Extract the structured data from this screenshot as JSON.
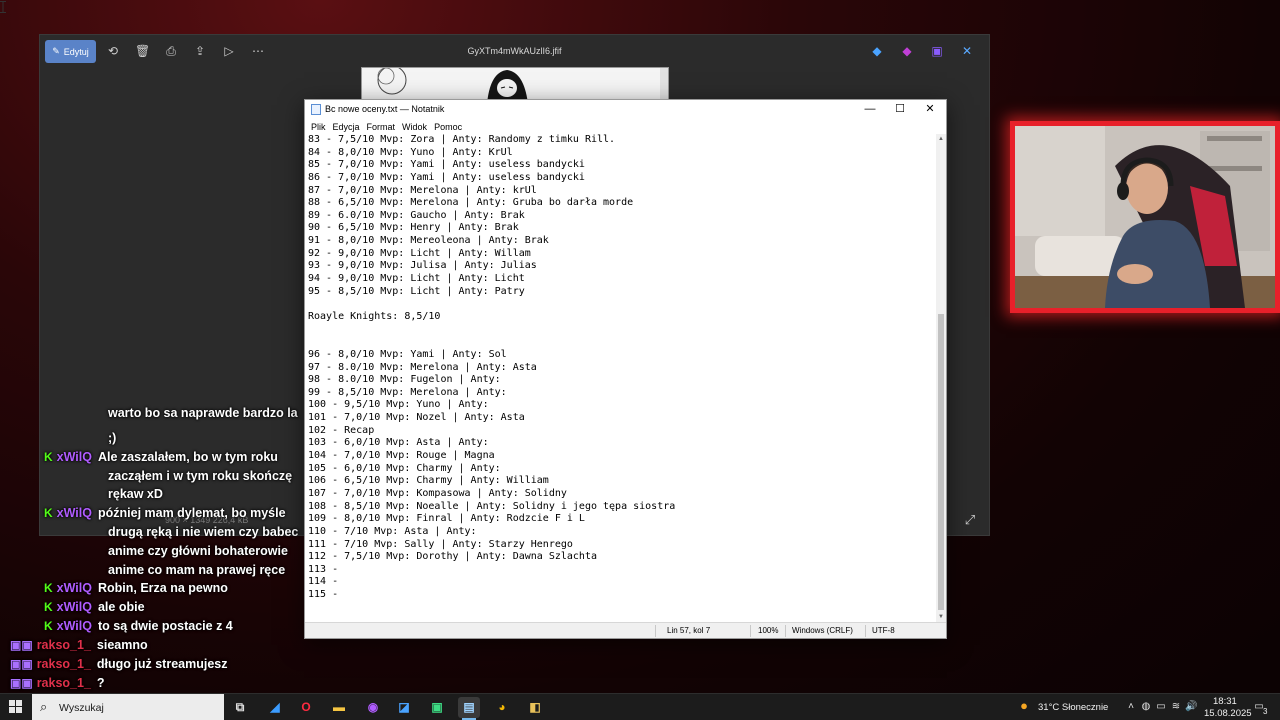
{
  "photos": {
    "edit_label": "Edytuj",
    "title": "GyXTm4mWkAUzlI6.jfif",
    "bottom_info": "900 × 1349    226,4 kB",
    "accent": "#5a83c8"
  },
  "notepad": {
    "title": "Bc nowe oceny.txt — Notatnik",
    "menu": [
      "Plik",
      "Edycja",
      "Format",
      "Widok",
      "Pomoc"
    ],
    "lines": [
      "83 - 7,5/10 Mvp: Zora | Anty: Randomy z timku Rill.",
      "84 - 8,0/10 Mvp: Yuno | Anty: KrUl",
      "85 - 7,0/10 Mvp: Yami | Anty: useless bandycki",
      "86 - 7,0/10 Mvp: Yami | Anty: useless bandycki",
      "87 - 7,0/10 Mvp: Merelona | Anty: krUl",
      "88 - 6,5/10 Mvp: Merelona | Anty: Gruba bo darła morde",
      "89 - 6.0/10 Mvp: Gaucho | Anty: Brak",
      "90 - 6,5/10 Mvp: Henry | Anty: Brak",
      "91 - 8,0/10 Mvp: Mereoleona | Anty: Brak",
      "92 - 9,0/10 Mvp: Licht | Anty: Willam",
      "93 - 9,0/10 Mvp: Julisa | Anty: Julias",
      "94 - 9,0/10 Mvp: Licht | Anty: Licht",
      "95 - 8,5/10 Mvp: Licht | Anty: Patry",
      "",
      "Roayle Knights: 8,5/10",
      "",
      "",
      "96 - 8,0/10 Mvp: Yami | Anty: Sol",
      "97 - 8.0/10 Mvp: Merelona | Anty: Asta",
      "98 - 8.0/10 Mvp: Fugelon | Anty:",
      "99 - 8,5/10 Mvp: Merelona | Anty:",
      "100 - 9,5/10 Mvp: Yuno | Anty:",
      "101 - 7,0/10 Mvp: Nozel | Anty: Asta",
      "102 - Recap",
      "103 - 6,0/10 Mvp: Asta | Anty:",
      "104 - 7,0/10 Mvp: Rouge | Magna",
      "105 - 6,0/10 Mvp: Charmy | Anty:",
      "106 - 6,5/10 Mvp: Charmy | Anty: William",
      "107 - 7,0/10 Mvp: Kompasowa | Anty: Solidny",
      "108 - 8,5/10 Mvp: Noealle | Anty: Solidny i jego tępa siostra",
      "109 - 8,0/10 Mvp: Finral | Anty: Rodzcie F i L",
      "110 - 7/10 Mvp: Asta | Anty:",
      "111 - 7/10 Mvp: Sally | Anty: Starzy Henrego",
      "112 - 7,5/10 Mvp: Dorothy | Anty: Dawna Szlachta",
      "113 -",
      "114 -",
      "115 -"
    ],
    "status": {
      "position": "Lin 57, kol 7",
      "zoom": "100%",
      "line_endings": "Windows (CRLF)",
      "encoding": "UTF-8"
    }
  },
  "chat": {
    "username_color": "#b05cff",
    "messages": [
      {
        "badge": "",
        "user": "",
        "text": "warto bo sa naprawde bardzo la"
      },
      {
        "badge": "",
        "user": "",
        "text": ";)"
      },
      {
        "badge": "K",
        "user": "xWilQ",
        "text": "Ale zaszalałem, bo w tym roku"
      },
      {
        "badge": "",
        "user": "",
        "text": "zacząłem i w tym roku skończę"
      },
      {
        "badge": "",
        "user": "",
        "text": "rękaw xD"
      },
      {
        "badge": "K",
        "user": "xWilQ",
        "text": "później mam dylemat, bo myśle"
      },
      {
        "badge": "",
        "user": "",
        "text": "drugą ręką i nie wiem czy babec"
      },
      {
        "badge": "",
        "user": "",
        "text": "anime czy główni bohaterowie"
      },
      {
        "badge": "",
        "user": "",
        "text": "anime co mam na prawej ręce"
      },
      {
        "badge": "K",
        "user": "xWilQ",
        "text": "Robin, Erza na pewno"
      },
      {
        "badge": "K",
        "user": "xWilQ",
        "text": "ale obie"
      },
      {
        "badge": "K",
        "user": "xWilQ",
        "text": "to są dwie postacie z 4"
      },
      {
        "badge": "TW",
        "user": "rakso_1_",
        "text": "sieamno"
      },
      {
        "badge": "TW",
        "user": "rakso_1_",
        "text": "długo już streamujesz"
      },
      {
        "badge": "TW",
        "user": "rakso_1_",
        "text": "?"
      }
    ]
  },
  "taskbar": {
    "search_placeholder": "Wyszukaj",
    "weather": "31°C  Słonecznie",
    "time": "18:31",
    "date": "15.08.2025",
    "notifications": "3"
  }
}
